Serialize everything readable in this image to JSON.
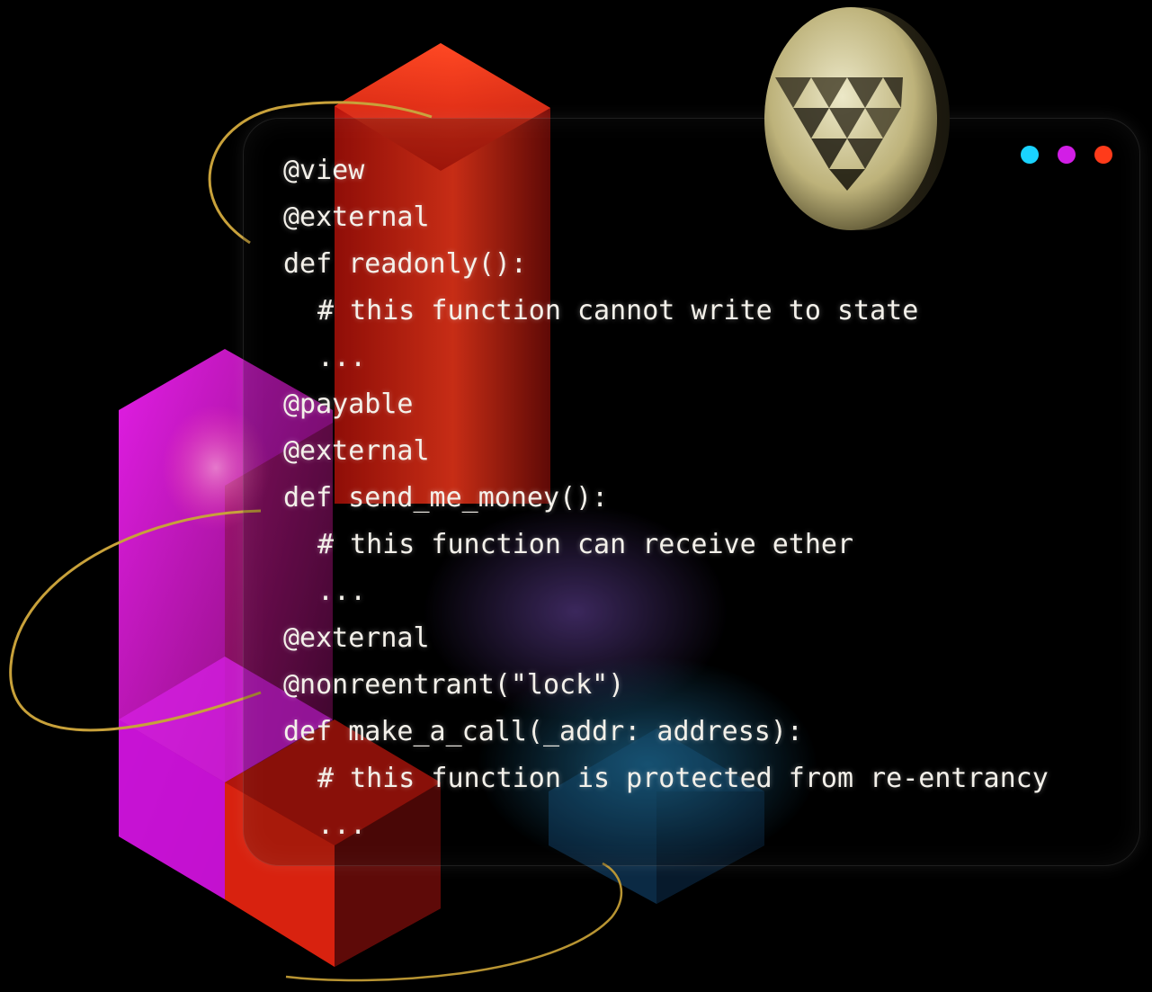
{
  "colors": {
    "background": "#000000",
    "dot_cyan": "#1ad3ff",
    "dot_magenta": "#d21ee6",
    "dot_red": "#ff3b1a",
    "code_text": "#f4f1ea",
    "coin_gold": "#c9c08a",
    "orbit_gold": "#c8a13a"
  },
  "icons": {
    "window_controls": [
      "cyan-dot-icon",
      "magenta-dot-icon",
      "red-dot-icon"
    ],
    "coin": "vyper-logo-coin-icon"
  },
  "code": {
    "lines": [
      "@view",
      "@external",
      "def readonly():",
      "# this function cannot write to state",
      "...",
      "@payable",
      "@external",
      "def send_me_money():",
      "# this function can receive ether",
      "...",
      "@external",
      "@nonreentrant(\"lock\")",
      "def make_a_call(_addr: address):",
      "# this function is protected from re-entrancy",
      "..."
    ]
  }
}
